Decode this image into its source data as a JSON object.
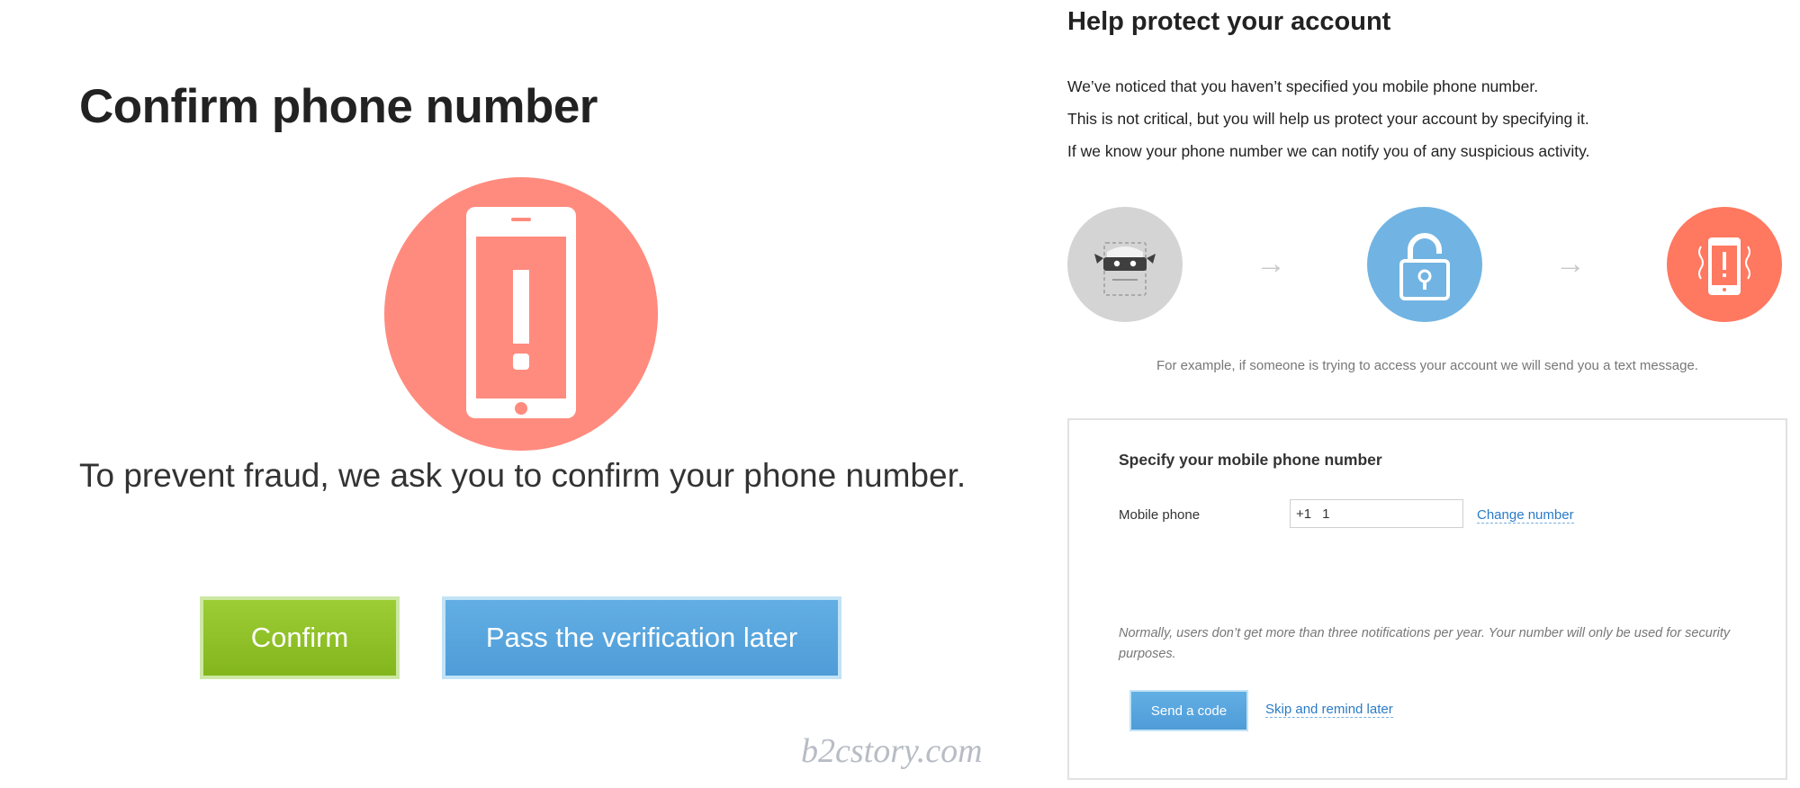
{
  "left": {
    "title": "Confirm phone number",
    "message": "To prevent fraud, we ask you to confirm your phone number.",
    "confirm_label": "Confirm",
    "later_label": "Pass the verification later",
    "watermark": "b2cstory.com",
    "hero_icon": "phone-alert-icon"
  },
  "right": {
    "title": "Help protect your account",
    "paragraphs": [
      "We’ve noticed that you haven’t specified you mobile phone number.",
      "This is not critical, but you will help us protect your account by specifying it.",
      "If we know your phone number we can notify you of any suspicious activity."
    ],
    "steps": [
      {
        "icon": "masked-thief-icon",
        "color": "#d4d4d4"
      },
      {
        "icon": "lock-icon",
        "color": "#71b4e3"
      },
      {
        "icon": "phone-alert-icon",
        "color": "#ff7860"
      }
    ],
    "example": "For example, if someone is trying to access your account we will send you a text message.",
    "form": {
      "title": "Specify your mobile phone number",
      "phone_label": "Mobile phone",
      "country_code": "+1",
      "phone_value": "1",
      "change_link": "Change number",
      "note": "Normally, users don’t get more than three notifications per year. Your number will only be used for security purposes.",
      "send_label": "Send a code",
      "skip_link": "Skip and remind later"
    }
  },
  "colors": {
    "confirm_green": "#8fc127",
    "blue_button": "#58a6de",
    "link_blue": "#2a7bc8",
    "alert_red": "#ff8b7e"
  }
}
